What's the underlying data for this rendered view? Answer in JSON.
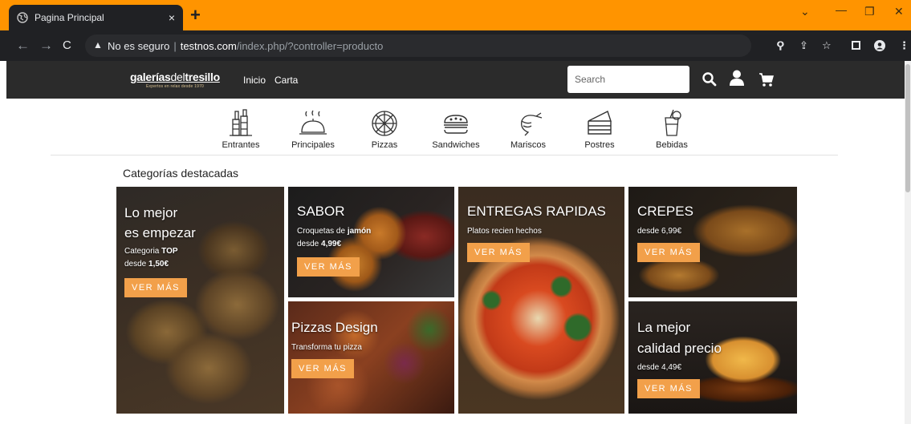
{
  "browser": {
    "tab_title": "Pagina Principal",
    "tab_close": "×",
    "new_tab": "+",
    "security_text": "No es seguro",
    "url_host": "testnos.com",
    "url_path": "/index.php/?controller=producto"
  },
  "site": {
    "logo_bold": "galerías",
    "logo_mid": "del",
    "logo_end": "tresillo",
    "logo_tagline": "Expertos en relax desde 1970",
    "menu": [
      "Inicio",
      "Carta"
    ],
    "search_placeholder": "Search"
  },
  "categories": [
    "Entrantes",
    "Principales",
    "Pizzas",
    "Sandwiches",
    "Mariscos",
    "Postres",
    "Bebidas"
  ],
  "featured_title": "Categorías destacadas",
  "tiles": {
    "top": {
      "h1": "Lo mejor",
      "h2": "es empezar",
      "s1": "Categoria ",
      "s1b": "TOP",
      "s2": "desde ",
      "s2b": "1,50€",
      "btn": "VER MÁS"
    },
    "sabor": {
      "h": "SABOR",
      "s1": "Croquetas de ",
      "s1b": "jamón",
      "s2": "desde ",
      "s2b": "4,99€",
      "btn": "VER MÁS"
    },
    "entregas": {
      "h": "ENTREGAS RAPIDAS",
      "s": "Platos recien hechos",
      "btn": "VER MÁS"
    },
    "crepes": {
      "h": "CREPES",
      "s": "desde 6,99€",
      "btn": "VER MÁS"
    },
    "pizzas": {
      "h": "Pizzas Design",
      "s": "Transforma tu pizza",
      "btn": "VER MÁS"
    },
    "calidad": {
      "h1": "La mejor",
      "h2": "calidad precio",
      "s": "desde 4,49€",
      "btn": "VER MÁS"
    }
  },
  "colors": {
    "chrome_tab_bar": "#ff9400",
    "header_bg": "#2b2b2b",
    "button": "#f2a04a"
  }
}
